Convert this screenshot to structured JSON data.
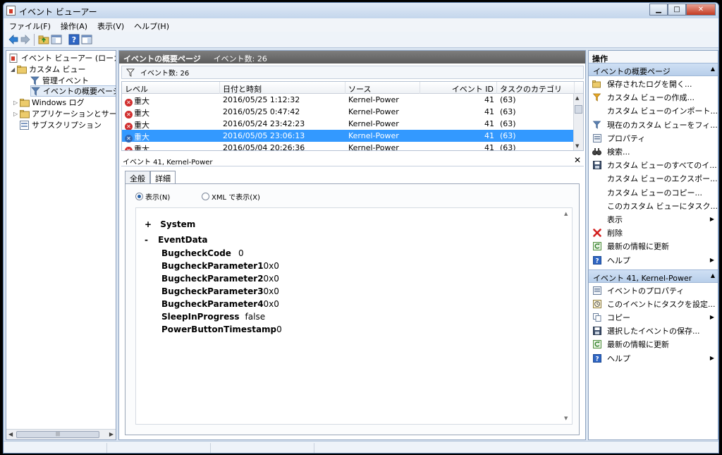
{
  "window": {
    "title": "イベント ビューアー"
  },
  "menu": [
    "ファイル(F)",
    "操作(A)",
    "表示(V)",
    "ヘルプ(H)"
  ],
  "tree": {
    "root": "イベント ビューアー (ローカル",
    "custom_views": "カスタム ビュー",
    "admin_events": "管理イベント",
    "summary_page": "イベントの概要ページ",
    "windows_logs": "Windows ログ",
    "app_service_logs": "アプリケーションとサービ",
    "subscriptions": "サブスクリプション"
  },
  "center": {
    "header_title": "イベントの概要ページ",
    "header_count": "イベント数: 26",
    "filter_text": "イベント数: 26",
    "columns": [
      "レベル",
      "日付と時刻",
      "ソース",
      "イベント ID",
      "タスクのカテゴリ"
    ],
    "rows": [
      {
        "level": "重大",
        "datetime": "2016/05/25 1:12:32",
        "source": "Kernel-Power",
        "id": "41",
        "task": "(63)"
      },
      {
        "level": "重大",
        "datetime": "2016/05/25 0:47:42",
        "source": "Kernel-Power",
        "id": "41",
        "task": "(63)"
      },
      {
        "level": "重大",
        "datetime": "2016/05/24 23:42:23",
        "source": "Kernel-Power",
        "id": "41",
        "task": "(63)"
      },
      {
        "level": "重大",
        "datetime": "2016/05/05 23:06:13",
        "source": "Kernel-Power",
        "id": "41",
        "task": "(63)"
      },
      {
        "level": "重大",
        "datetime": "2016/05/04 20:26:36",
        "source": "Kernel-Power",
        "id": "41",
        "task": "(63)"
      }
    ],
    "selected_row": 3,
    "detail_title": "イベント 41, Kernel-Power",
    "tabs": [
      "全般",
      "詳細"
    ],
    "radio_view": "表示(N)",
    "radio_xml": "XML で表示(X)",
    "xml": {
      "system": "System",
      "eventdata": "EventData",
      "plus": "+",
      "minus": "-",
      "fields": [
        {
          "k": "BugcheckCode",
          "v": "0"
        },
        {
          "k": "BugcheckParameter1",
          "v": "0x0"
        },
        {
          "k": "BugcheckParameter2",
          "v": "0x0"
        },
        {
          "k": "BugcheckParameter3",
          "v": "0x0"
        },
        {
          "k": "BugcheckParameter4",
          "v": "0x0"
        },
        {
          "k": "SleepInProgress",
          "v": "false"
        },
        {
          "k": "PowerButtonTimestamp",
          "v": "0"
        }
      ]
    }
  },
  "actions": {
    "title": "操作",
    "section1": "イベントの概要ページ",
    "items1": [
      "保存されたログを開く...",
      "カスタム ビューの作成...",
      "カスタム ビューのインポート...",
      "現在のカスタム ビューをフィ...",
      "プロパティ",
      "検索...",
      "カスタム ビューのすべてのイ...",
      "カスタム ビューのエクスポー...",
      "カスタム ビューのコピー...",
      "このカスタム ビューにタスク...",
      "表示",
      "削除",
      "最新の情報に更新",
      "ヘルプ"
    ],
    "section2": "イベント 41, Kernel-Power",
    "items2": [
      "イベントのプロパティ",
      "このイベントにタスクを設定...",
      "コピー",
      "選択したイベントの保存...",
      "最新の情報に更新",
      "ヘルプ"
    ]
  }
}
